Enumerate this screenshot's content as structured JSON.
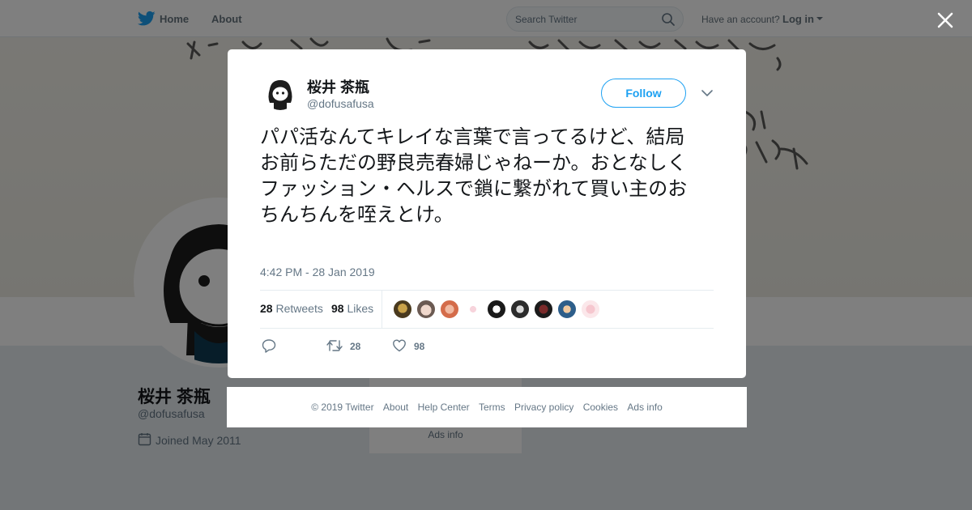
{
  "topnav": {
    "home": "Home",
    "about": "About",
    "search_placeholder": "Search Twitter",
    "have_account": "Have an account?",
    "login": "Log in"
  },
  "profile": {
    "name": "桜井 茶瓶",
    "handle": "@dofusafusa",
    "joined": "Joined May 2011",
    "sidebar_ads": "Ads info"
  },
  "tweet": {
    "author_name": "桜井 茶瓶",
    "author_handle": "@dofusafusa",
    "follow_label": "Follow",
    "text": "パパ活なんてキレイな言葉で言ってるけど、結局お前らただの野良売春婦じゃねーか。おとなしくファッション・ヘルスで鎖に繋がれて買い主のおちんちんを咥えとけ。",
    "timestamp": "4:42 PM - 28 Jan 2019",
    "retweets_count": "28",
    "retweets_label": "Retweets",
    "likes_count": "98",
    "likes_label": "Likes",
    "action_retweet_count": "28",
    "action_like_count": "98"
  },
  "footer": {
    "copyright": "© 2019 Twitter",
    "about": "About",
    "help": "Help Center",
    "terms": "Terms",
    "privacy": "Privacy policy",
    "cookies": "Cookies",
    "ads": "Ads info"
  },
  "colors": {
    "brand_blue": "#1da1f2",
    "secondary_text": "#657786",
    "primary_text": "#14171a"
  },
  "icons": [
    "twitter-bird-icon",
    "search-icon",
    "caret-down-icon",
    "close-icon",
    "calendar-icon",
    "reply-icon",
    "retweet-icon",
    "heart-icon",
    "chevron-down-icon"
  ]
}
